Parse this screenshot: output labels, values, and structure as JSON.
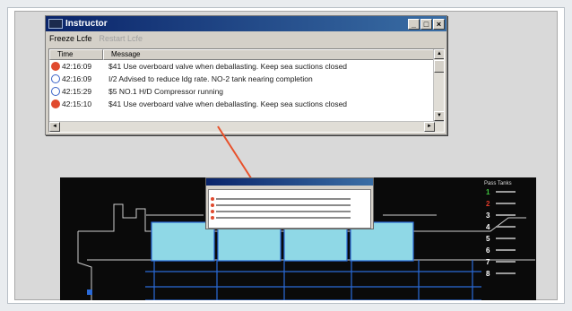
{
  "window": {
    "title": "Instructor",
    "controls": {
      "minimize": "_",
      "maximize": "□",
      "close": "×"
    }
  },
  "menu": {
    "freeze": "Freeze Lcfe",
    "restart": "Restart Lcfe"
  },
  "log": {
    "columns": [
      "Time",
      "Message"
    ],
    "rows": [
      {
        "time": "42:16:09",
        "icon": "alarm",
        "message": "$41 Use overboard valve when deballasting. Keep sea suctions closed"
      },
      {
        "time": "42:16:09",
        "icon": "info",
        "message": "I/2 Advised to reduce ldg rate. NO-2 tank nearing completion"
      },
      {
        "time": "42:15:29",
        "icon": "info",
        "message": "$5 NO.1 H/D Compressor running"
      },
      {
        "time": "42:15:10",
        "icon": "alarm",
        "message": "$41 Use overboard valve when deballasting. Keep sea suctions closed"
      }
    ]
  },
  "legend": {
    "header": "Pass   Tanks",
    "items": [
      {
        "num": "1",
        "color": "#3fc43f"
      },
      {
        "num": "2",
        "color": "#e03a2a"
      },
      {
        "num": "3",
        "color": "#ffffff"
      },
      {
        "num": "4",
        "color": "#ffffff"
      },
      {
        "num": "5",
        "color": "#ffffff"
      },
      {
        "num": "6",
        "color": "#ffffff"
      },
      {
        "num": "7",
        "color": "#ffffff"
      },
      {
        "num": "8",
        "color": "#ffffff"
      }
    ]
  },
  "colors": {
    "accent_alarm": "#e04a2e",
    "tank_fill": "#8fd8e6",
    "tank_outline": "#2a6ad8",
    "pointer": "#e8502a"
  }
}
